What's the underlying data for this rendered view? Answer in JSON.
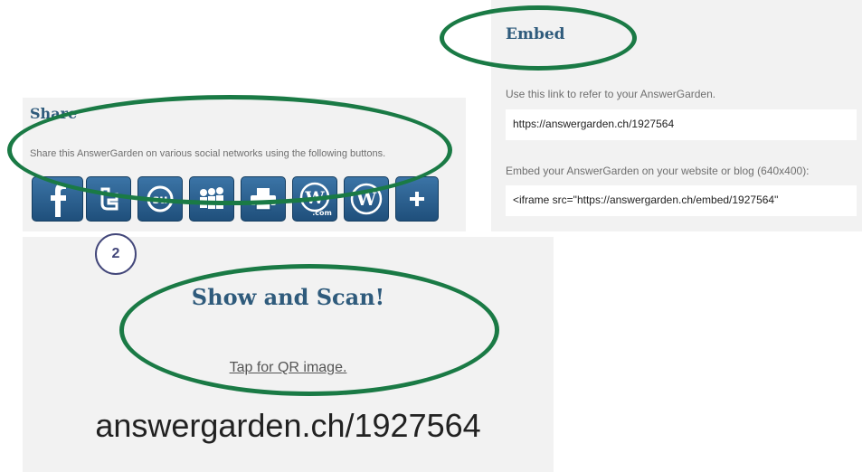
{
  "share": {
    "title": "Share",
    "description": "Share this AnswerGarden on various social networks using the following buttons.",
    "buttons": [
      {
        "name": "facebook-icon",
        "glyph": "f"
      },
      {
        "name": "twitter-icon",
        "glyph": "t"
      },
      {
        "name": "stumbleupon-icon",
        "glyph": "su"
      },
      {
        "name": "myspace-icon",
        "glyph": "m"
      },
      {
        "name": "printer-icon",
        "glyph": "p"
      },
      {
        "name": "wordpress-com-icon",
        "glyph": "W"
      },
      {
        "name": "wordpress-icon",
        "glyph": "W"
      },
      {
        "name": "more-icon",
        "glyph": "+"
      }
    ]
  },
  "embed": {
    "title": "Embed",
    "link_label": "Use this link to refer to your AnswerGarden.",
    "link_value": "https://answergarden.ch/1927564",
    "embed_label": "Embed your AnswerGarden on your website or blog (640x400):",
    "embed_value": "<iframe src=\"https://answergarden.ch/embed/1927564\""
  },
  "qr": {
    "title": "Show and Scan!",
    "link": "Tap for QR image.",
    "url": "answergarden.ch/1927564"
  },
  "annotation": {
    "step_number": "2",
    "color": "#1a7a45",
    "badge_color": "#43477a"
  }
}
